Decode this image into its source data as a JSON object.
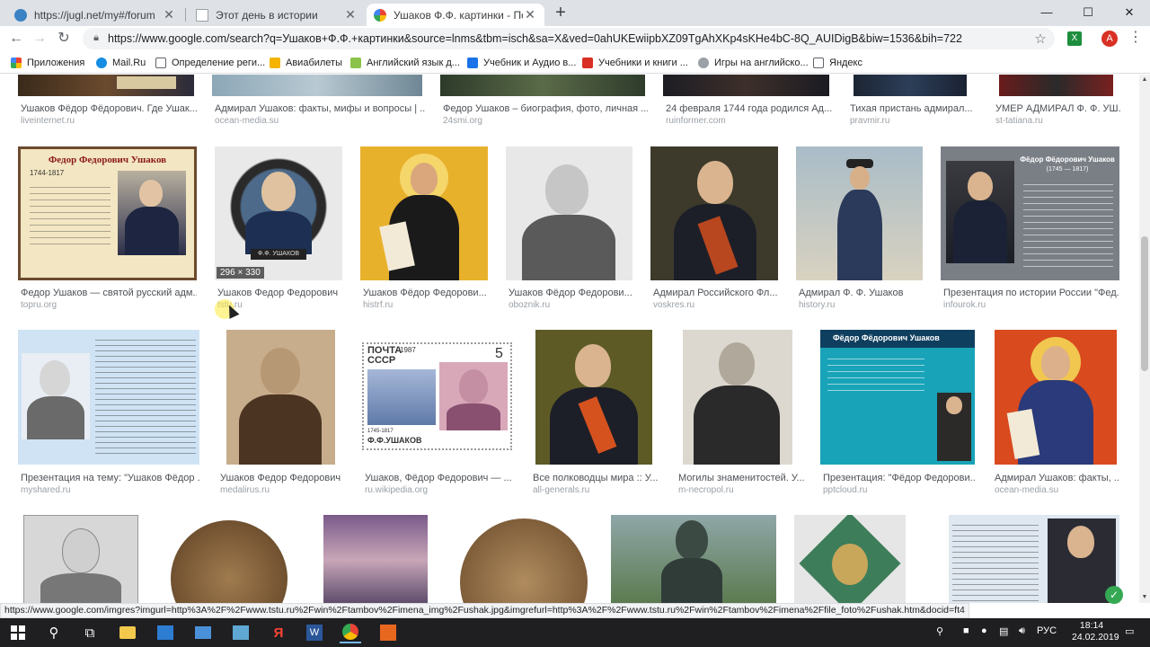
{
  "tabs": [
    {
      "title": "https://jugl.net/my#/forum",
      "fav_color": "#3b82c4"
    },
    {
      "title": "Этот день в истории",
      "fav_color": "#9aa0a6"
    },
    {
      "title": "Ушаков Ф.Ф. картинки - Поиск в",
      "fav_color": "#4285f4"
    }
  ],
  "window_controls": {
    "minimize": "—",
    "maximize": "☐",
    "close": "✕"
  },
  "address_bar": {
    "url": "https://www.google.com/search?q=Ушаков+Ф.Ф.+картинки&source=lnms&tbm=isch&sa=X&ved=0ahUKEwiipbXZ09TgAhXKp4sKHe4bC-8Q_AUIDigB&biw=1536&bih=722"
  },
  "profile_initial": "A",
  "bookmarks": [
    {
      "label": "Приложения",
      "color": "#ea4335"
    },
    {
      "label": "Mail.Ru",
      "color": "#168de2"
    },
    {
      "label": "Определение реги...",
      "color": "#5f6368"
    },
    {
      "label": "Авиабилеты",
      "color": "#f4b400"
    },
    {
      "label": "Английский язык д...",
      "color": "#8bc34a"
    },
    {
      "label": "Учебник и Аудио в...",
      "color": "#1a73e8"
    },
    {
      "label": "Учебники и книги ...",
      "color": "#d93025"
    },
    {
      "label": "Игры на английско...",
      "color": "#9aa0a6"
    },
    {
      "label": "Яндекс",
      "color": "#5f6368"
    }
  ],
  "results_row0": [
    {
      "caption": "Ушаков Фёдор Фёдорович. Где Ушак...",
      "source": "liveinternet.ru"
    },
    {
      "caption": "Адмирал Ушаков: факты, мифы и вопросы | ...",
      "source": "ocean-media.su"
    },
    {
      "caption": "Федор Ушаков – биография, фото, личная ...",
      "source": "24smi.org"
    },
    {
      "caption": "24 февраля 1744 года родился Ад...",
      "source": "ruinformer.com"
    },
    {
      "caption": "Тихая пристань адмирал...",
      "source": "pravmir.ru"
    },
    {
      "caption": "УМЕР АДМИРАЛ Ф. Ф. УШ...",
      "source": "st-tatiana.ru"
    }
  ],
  "results_row1": [
    {
      "caption": "Федор Ушаков — святой русский адм...",
      "source": "topru.org",
      "img_title": "Федор Федорович Ушаков",
      "img_years": "1744-1817"
    },
    {
      "caption": "Ушаков Федор Федорович",
      "source": "tstu.ru",
      "dims": "296 × 330",
      "plate": "Ф.Ф. УШАКОВ"
    },
    {
      "caption": "Ушаков Фёдор Федорови...",
      "source": "histrf.ru"
    },
    {
      "caption": "Ушаков Фёдор Федорови...",
      "source": "oboznik.ru"
    },
    {
      "caption": "Адмирал Российского Фл...",
      "source": "voskres.ru"
    },
    {
      "caption": "Адмирал Ф. Ф. Ушаков",
      "source": "histоry.ru"
    },
    {
      "caption": "Презентация по истории России \"Фед...",
      "source": "infourok.ru",
      "img_title": "Фёдор Фёдорович Ушаков",
      "img_years": "(1745 — 1817)"
    }
  ],
  "results_row2": [
    {
      "caption": "Презентация на тему: \"Ушаков Фёдор ...",
      "source": "myshared.ru"
    },
    {
      "caption": "Ушаков Федор Федорович",
      "source": "medalirus.ru"
    },
    {
      "caption": "Ушаков, Фёдор Федорович — ...",
      "source": "ru.wikipedia.org",
      "stamp_text": "ПОЧТА СССР",
      "stamp_value": "5",
      "stamp_name": "Ф.Ф.УШАКОВ",
      "stamp_years": "1745-1817",
      "stamp_year": "1987"
    },
    {
      "caption": "Все полководцы мира :: У...",
      "source": "all-generals.ru"
    },
    {
      "caption": "Могилы знаменитостей. У...",
      "source": "m-necropol.ru"
    },
    {
      "caption": "Презентация: \"Фёдор Федорови...",
      "source": "pptcloud.ru",
      "img_title": "Фёдор Фёдорович Ушаков"
    },
    {
      "caption": "Адмирал Ушаков: факты, ...",
      "source": "ocean-media.su"
    }
  ],
  "status_url": "https://www.google.com/imgres?imgurl=http%3A%2F%2Fwww.tstu.ru%2Fwin%2Ftambov%2Fimena_img%2Fushak.jpg&imgrefurl=http%3A%2F%2Fwww.tstu.ru%2Fwin%2Ftambov%2Fimena%2Ffile_foto%2Fushak.htm&docid=ft4",
  "tray": {
    "lang": "РУС",
    "time": "18:14",
    "date": "24.02.2019"
  },
  "colors": {
    "tabstrip": "#dee1e6",
    "taskbar": "#1f1f22",
    "accent": "#1a73e8"
  }
}
